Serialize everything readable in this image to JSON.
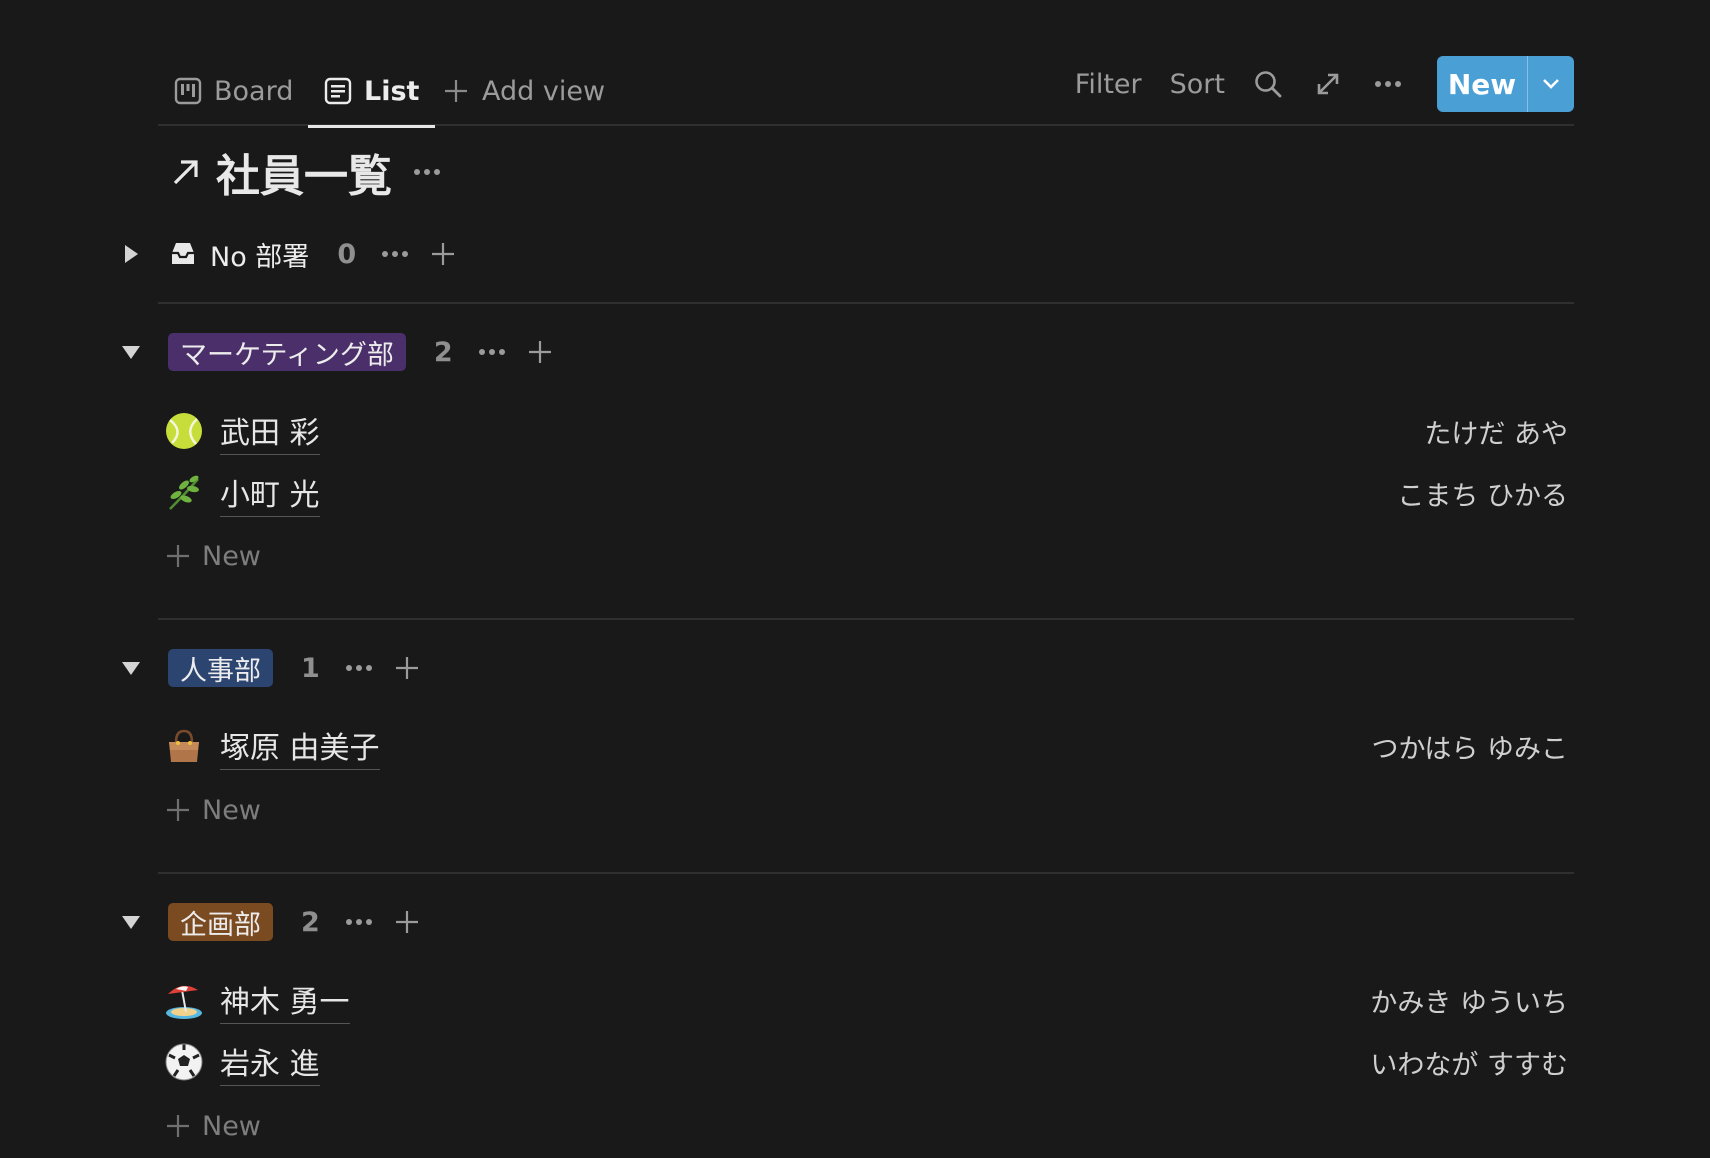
{
  "toolbar": {
    "tabs": [
      {
        "label": "Board",
        "icon": "board-icon"
      },
      {
        "label": "List",
        "icon": "list-icon",
        "active": true
      },
      {
        "label": "Add view",
        "icon": "plus-icon"
      }
    ],
    "filter_label": "Filter",
    "sort_label": "Sort",
    "new_label": "New"
  },
  "title": "社員一覧",
  "no_dept": {
    "label": "No 部署",
    "count": "0"
  },
  "groups": [
    {
      "label": "マーケティング部",
      "count": "2",
      "color": "#4b2f6b",
      "rows": [
        {
          "emoji": "tennis-ball-icon",
          "name": "武田 彩",
          "kana": "たけだ あや"
        },
        {
          "emoji": "herb-icon",
          "name": "小町 光",
          "kana": "こまち ひかる"
        }
      ],
      "new_label": "New"
    },
    {
      "label": "人事部",
      "count": "1",
      "color": "#2b4470",
      "rows": [
        {
          "emoji": "handbag-icon",
          "name": "塚原 由美子",
          "kana": "つかはら ゆみこ"
        }
      ],
      "new_label": "New"
    },
    {
      "label": "企画部",
      "count": "2",
      "color": "#7a4a20",
      "rows": [
        {
          "emoji": "beach-umbrella-icon",
          "name": "神木 勇一",
          "kana": "かみき ゆういち"
        },
        {
          "emoji": "soccer-ball-icon",
          "name": "岩永 進",
          "kana": "いわなが すすむ"
        }
      ],
      "new_label": "New"
    }
  ],
  "colors": {
    "accent": "#4a9fd5",
    "background": "#191919"
  }
}
